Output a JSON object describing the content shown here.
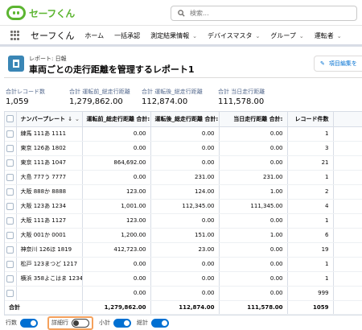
{
  "app": {
    "logo_text": "セーフくん",
    "search_placeholder": "検索...",
    "app_name": "セーフくん",
    "nav": [
      "ホーム",
      "一括承認",
      "測定結果情報",
      "デバイスマスタ",
      "グループ",
      "運転者"
    ]
  },
  "report": {
    "type_label": "レポート: 日報",
    "title": "車両ごとの走行距離を管理するレポート1",
    "edit_button": "項目編集を"
  },
  "summary": [
    {
      "label": "合計レコード数",
      "value": "1,059"
    },
    {
      "label": "合計 運転前_総走行距離",
      "value": "1,279,862.00"
    },
    {
      "label": "合計 運転後_総走行距離",
      "value": "112,874.00"
    },
    {
      "label": "合計 当日走行距離",
      "value": "111,578.00"
    }
  ],
  "table": {
    "headers": [
      "ナンバープレート",
      "運転前_総走行距離 合計:",
      "運転後_総走行距離 合計:",
      "当日走行距離 合計:",
      "レコード件数"
    ],
    "rows": [
      [
        "練馬 111あ 1111",
        "0.00",
        "0.00",
        "0.00",
        "1"
      ],
      [
        "東京 126あ 1802",
        "0.00",
        "0.00",
        "0.00",
        "3"
      ],
      [
        "東京 111あ 1047",
        "864,692.00",
        "0.00",
        "0.00",
        "21"
      ],
      [
        "大島 777う 7777",
        "0.00",
        "231.00",
        "231.00",
        "1"
      ],
      [
        "大阪 888か 8888",
        "123.00",
        "124.00",
        "1.00",
        "2"
      ],
      [
        "大阪 123あ 1234",
        "1,001.00",
        "112,345.00",
        "111,345.00",
        "4"
      ],
      [
        "大阪 111あ 1127",
        "123.00",
        "0.00",
        "0.00",
        "1"
      ],
      [
        "大阪 001か 0001",
        "1,200.00",
        "151.00",
        "1.00",
        "6"
      ],
      [
        "神奈川 126ほ 1819",
        "412,723.00",
        "23.00",
        "0.00",
        "19"
      ],
      [
        "松戸 123まつど 1217",
        "0.00",
        "0.00",
        "0.00",
        "1"
      ],
      [
        "横浜 358よこはま 1234",
        "0.00",
        "0.00",
        "0.00",
        "1"
      ],
      [
        "",
        "0.00",
        "0.00",
        "0.00",
        "999"
      ]
    ],
    "total": [
      "合計",
      "1,279,862.00",
      "112,874.00",
      "111,578.00",
      "1059"
    ]
  },
  "footer": {
    "labels": [
      "行数",
      "詳細行",
      "小計",
      "総計"
    ],
    "states": [
      true,
      false,
      true,
      true
    ]
  },
  "colors": {
    "brand": "#5cb531",
    "accent": "#0070d2",
    "highlight": "#f5a15c"
  }
}
